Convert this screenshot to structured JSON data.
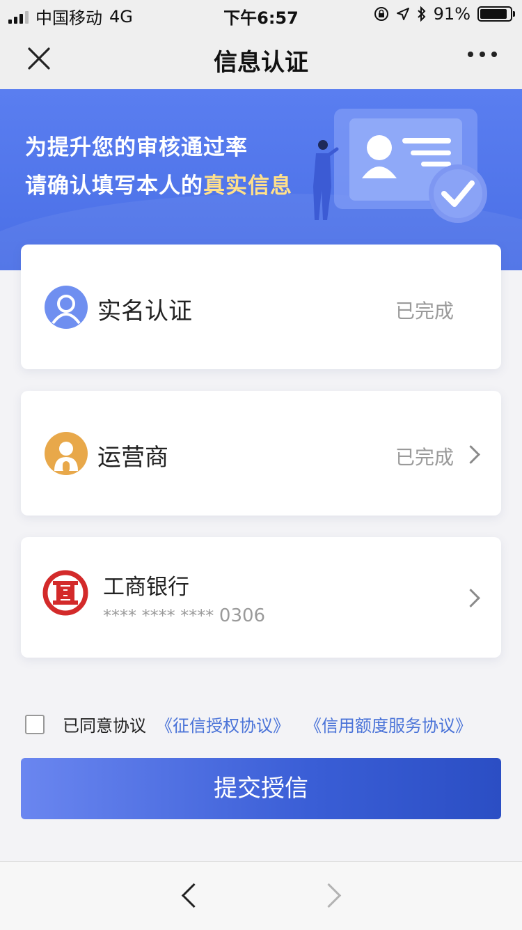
{
  "status_bar": {
    "carrier": "中国移动",
    "network": "4G",
    "time": "下午6:57",
    "battery": "91%",
    "battery_level": 0.91
  },
  "nav": {
    "title": "信息认证"
  },
  "banner": {
    "line1": "为提升您的审核通过率",
    "line2_prefix": "请确认填写本人的",
    "line2_highlight": "真实信息"
  },
  "items": [
    {
      "label": "实名认证",
      "status": "已完成"
    },
    {
      "label": "运营商",
      "status": "已完成"
    }
  ],
  "bank": {
    "name": "工商银行",
    "card_mask": "**** **** ****",
    "card_last4": "0306"
  },
  "agreement": {
    "prefix": "已同意协议",
    "link1": "《征信授权协议》",
    "link2": "《信用额度服务协议》"
  },
  "submit_label": "提交授信",
  "colors": {
    "accent": "#4a6fe6",
    "highlight": "#ffe08a",
    "operator_icon": "#e8a84a",
    "bank_red": "#d32a2a",
    "link": "#4a73d8"
  },
  "icons": {
    "close": "close-icon",
    "more": "more-icon",
    "realname": "person-icon",
    "operator": "operator-person-icon",
    "bank": "icbc-logo",
    "back": "back-arrow-icon",
    "forward": "forward-arrow-icon"
  }
}
